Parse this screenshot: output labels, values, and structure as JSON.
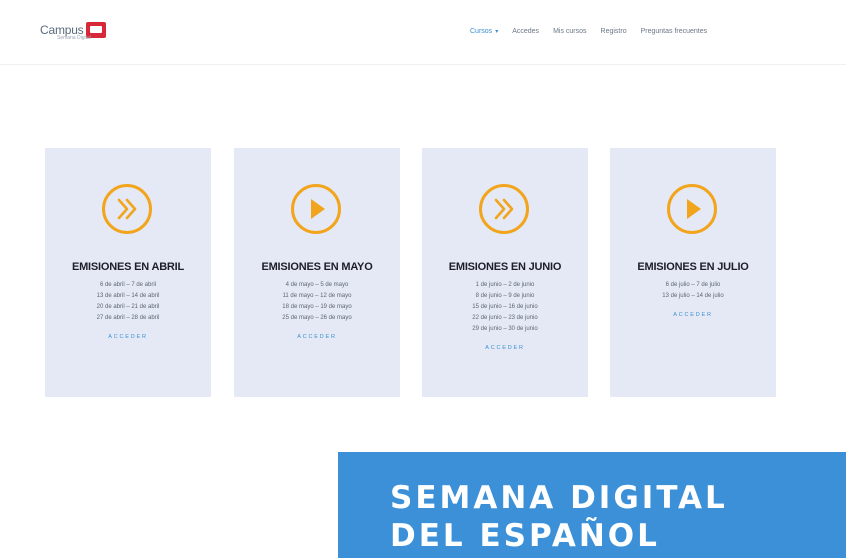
{
  "header": {
    "logo_text": "Campus",
    "logo_sub": "Semana Digital",
    "nav": [
      {
        "label": "Cursos",
        "active": true,
        "dropdown": true
      },
      {
        "label": "Accedes",
        "active": false
      },
      {
        "label": "Mis cursos",
        "active": false
      },
      {
        "label": "Registro",
        "active": false
      },
      {
        "label": "Preguntas frecuentes",
        "active": false
      }
    ]
  },
  "cards": [
    {
      "icon": "double-chevron-icon",
      "title": "EMISIONES EN ABRIL",
      "dates": [
        "6 de abril – 7 de abril",
        "13 de abril – 14 de abril",
        "20 de abril – 21 de abril",
        "27 de abril – 28 de abril"
      ],
      "access": "ACCEDER"
    },
    {
      "icon": "play-icon",
      "title": "EMISIONES EN MAYO",
      "dates": [
        "4 de mayo – 5 de mayo",
        "11 de mayo – 12 de mayo",
        "18 de mayo – 19 de mayo",
        "25 de mayo – 26 de mayo"
      ],
      "access": "ACCEDER"
    },
    {
      "icon": "double-chevron-icon",
      "title": "EMISIONES EN JUNIO",
      "dates": [
        "1 de junio – 2 de junio",
        "8 de junio – 9 de junio",
        "15 de junio – 16 de junio",
        "22 de junio – 23 de junio",
        "29 de junio – 30 de junio"
      ],
      "access": "ACCEDER"
    },
    {
      "icon": "play-icon",
      "title": "EMISIONES EN JULIO",
      "dates": [
        "6 de julio – 7 de julio",
        "13 de julio – 14 de julio"
      ],
      "access": "ACCEDER"
    }
  ],
  "banner": {
    "line1": "SEMANA DIGITAL",
    "line2": "DEL ESPAÑOL"
  },
  "colors": {
    "accent": "#f2a51c",
    "card_bg": "#e4e9f5",
    "banner": "#3b90d8",
    "link": "#3d8fd1"
  }
}
